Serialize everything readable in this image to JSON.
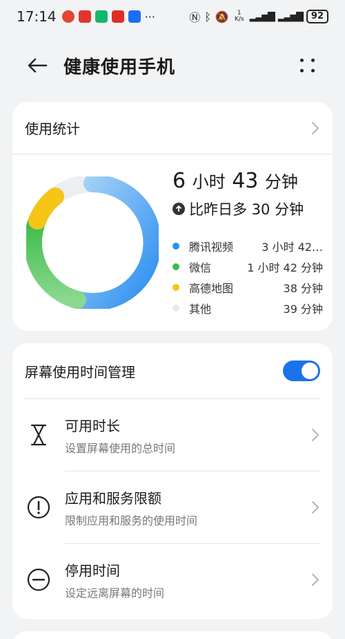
{
  "status": {
    "time": "17:14",
    "network_rate": "1 K/s",
    "battery": "92"
  },
  "header": {
    "title": "健康使用手机"
  },
  "usage": {
    "section_title": "使用统计",
    "total_hours": "6",
    "total_hours_unit": "小时",
    "total_minutes": "43",
    "total_minutes_unit": "分钟",
    "compare_text": "比昨日多 30 分钟",
    "legend": [
      {
        "name": "腾讯视频",
        "value": "3 小时 42…",
        "color": "#2b8ff0"
      },
      {
        "name": "微信",
        "value": "1 小时 42 分钟",
        "color": "#3dbb4a"
      },
      {
        "name": "高德地图",
        "value": "38 分钟",
        "color": "#f5c518"
      },
      {
        "name": "其他",
        "value": "39 分钟",
        "color": "#e9eaec"
      }
    ]
  },
  "screen_time": {
    "section_title": "屏幕使用时间管理",
    "toggle_on": true,
    "items": [
      {
        "title": "可用时长",
        "subtitle": "设置屏幕使用的总时间",
        "icon": "hourglass-icon"
      },
      {
        "title": "应用和服务限额",
        "subtitle": "限制应用和服务的使用时间",
        "icon": "alert-circle-icon"
      },
      {
        "title": "停用时间",
        "subtitle": "设定远离屏幕的时间",
        "icon": "minus-circle-icon"
      }
    ]
  }
}
